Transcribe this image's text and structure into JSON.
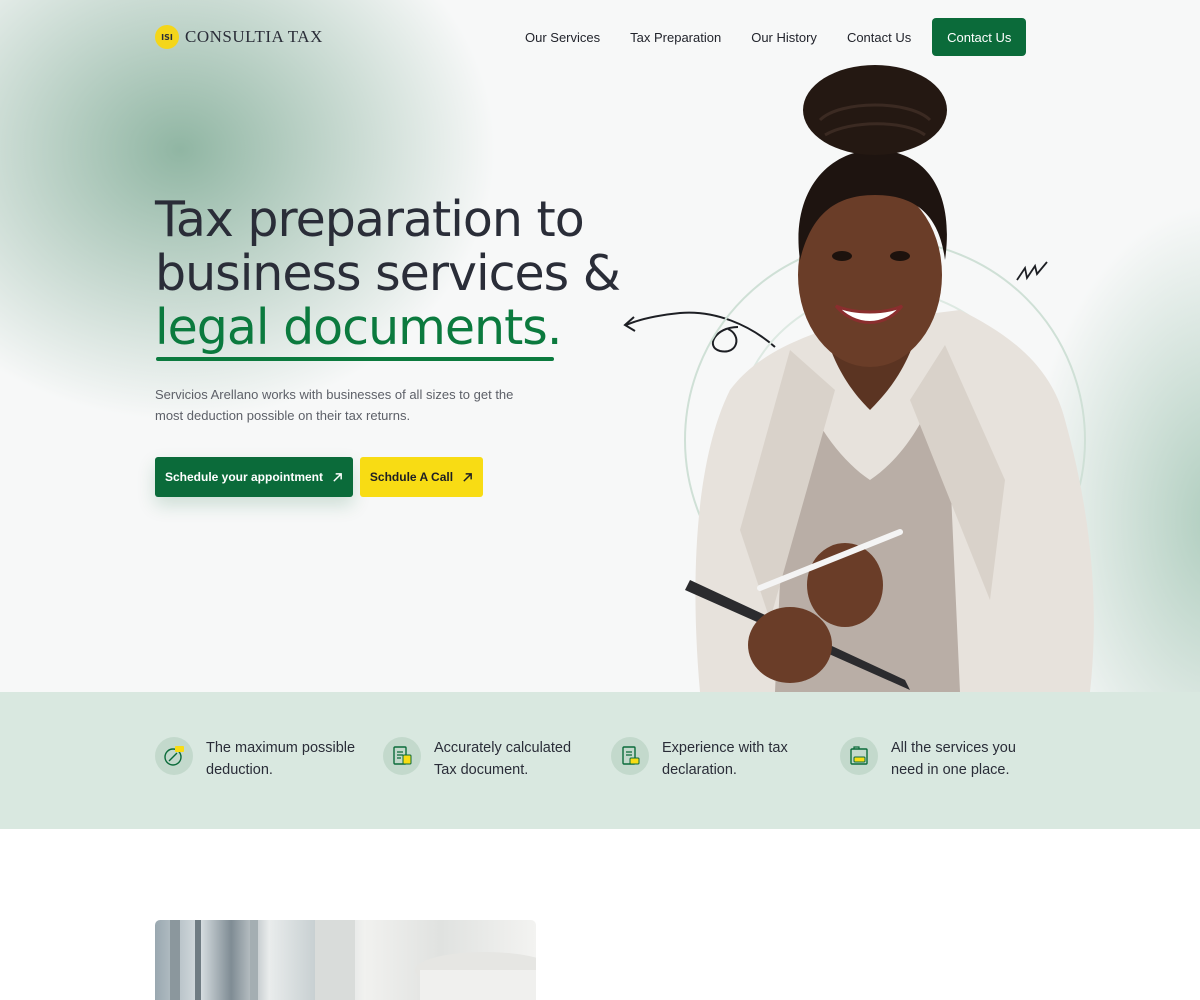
{
  "brand": {
    "logo_mark": "ISI",
    "name": "CONSULTIA TAX"
  },
  "nav": {
    "links": [
      "Our Services",
      "Tax Preparation",
      "Our History",
      "Contact Us"
    ],
    "cta": "Contact Us"
  },
  "hero": {
    "headline_line1": "Tax preparation to",
    "headline_line2": "business services &",
    "headline_line3": "legal documents.",
    "description": "Servicios Arellano works with businesses of all sizes to get the most deduction possible on their tax returns.",
    "primary_button": "Schedule your appointment",
    "secondary_button": "Schdule A Call"
  },
  "features": [
    {
      "text": "The maximum possible deduction.",
      "icon": "tax-percent-icon"
    },
    {
      "text": "Accurately calculated Tax document.",
      "icon": "tax-document-icon"
    },
    {
      "text": "Experience with tax declaration.",
      "icon": "tax-declaration-icon"
    },
    {
      "text": "All the services you need in one place.",
      "icon": "tax-folder-icon"
    }
  ],
  "colors": {
    "brand_green": "#0b6b3a",
    "accent_yellow": "#f8dc14",
    "band": "#d9e8e0"
  }
}
